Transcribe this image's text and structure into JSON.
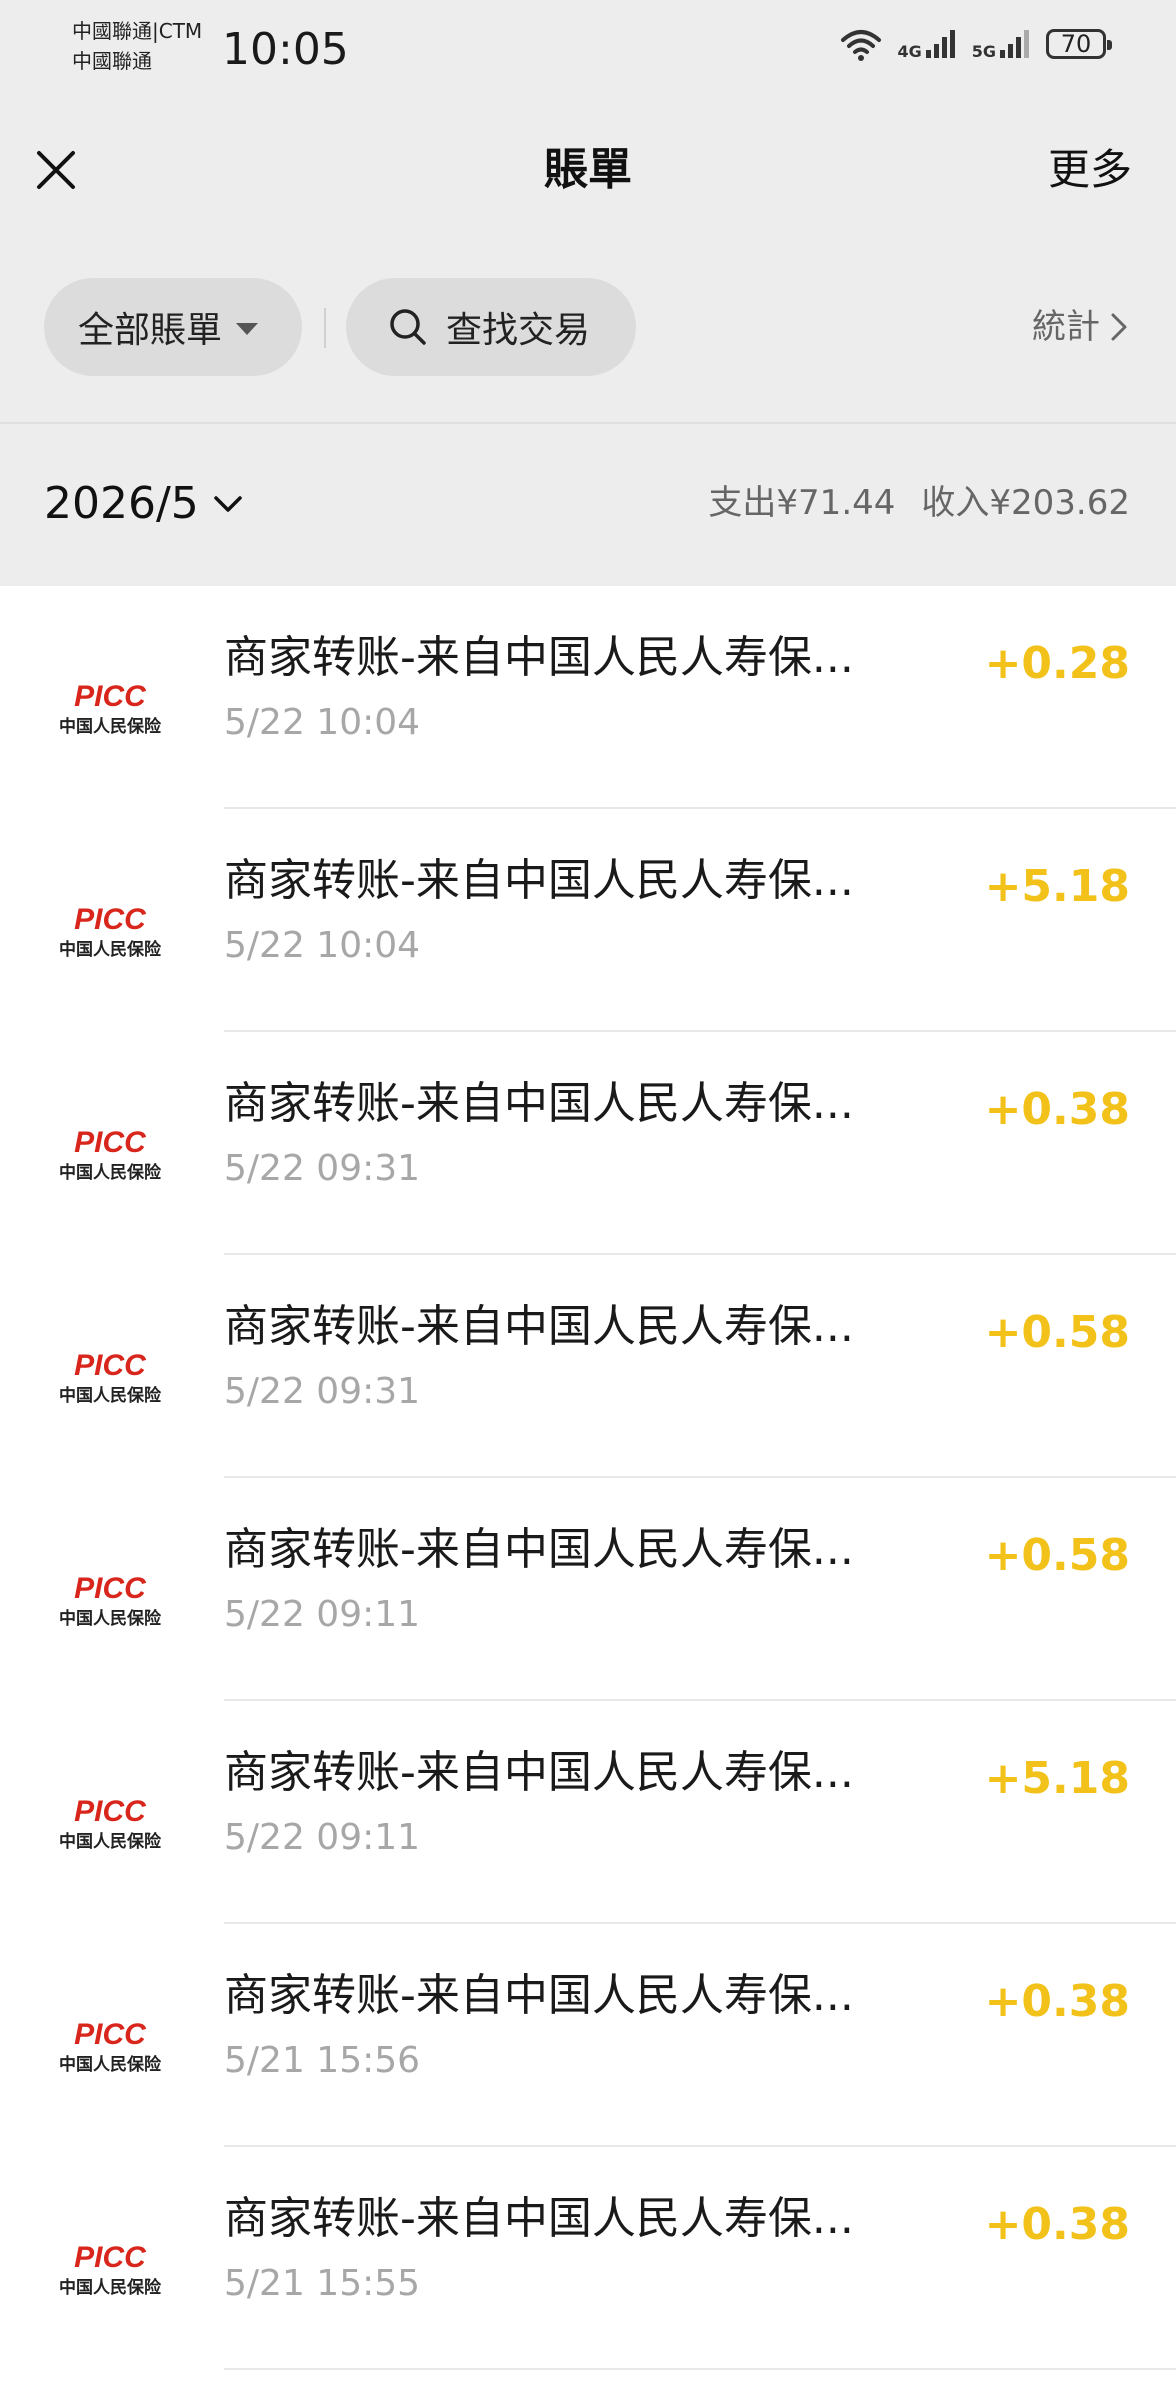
{
  "status_bar": {
    "carrier_line1": "中國聯通|CTM",
    "carrier_line2": "中國聯通",
    "time": "10:05",
    "network_4g": "4G",
    "network_5g": "5G",
    "battery": "70"
  },
  "nav": {
    "title": "賬單",
    "more": "更多"
  },
  "filters": {
    "all_bills": "全部賬單",
    "search": "查找交易",
    "stats": "統計"
  },
  "month": {
    "label": "2026/5",
    "expense": "支出¥71.44",
    "income": "收入¥203.62"
  },
  "logo": {
    "brand": "PICC",
    "name": "中国人民保险",
    "brand_color": "#d9261c"
  },
  "transactions": [
    {
      "title": "商家转账-来自中国人民人寿保...",
      "time": "5/22 10:04",
      "amount": "+0.28"
    },
    {
      "title": "商家转账-来自中国人民人寿保...",
      "time": "5/22 10:04",
      "amount": "+5.18"
    },
    {
      "title": "商家转账-来自中国人民人寿保...",
      "time": "5/22 09:31",
      "amount": "+0.38"
    },
    {
      "title": "商家转账-来自中国人民人寿保...",
      "time": "5/22 09:31",
      "amount": "+0.58"
    },
    {
      "title": "商家转账-来自中国人民人寿保...",
      "time": "5/22 09:11",
      "amount": "+0.58"
    },
    {
      "title": "商家转账-来自中国人民人寿保...",
      "time": "5/22 09:11",
      "amount": "+5.18"
    },
    {
      "title": "商家转账-来自中国人民人寿保...",
      "time": "5/21 15:56",
      "amount": "+0.38"
    },
    {
      "title": "商家转账-来自中国人民人寿保...",
      "time": "5/21 15:55",
      "amount": "+0.38"
    }
  ],
  "colors": {
    "income_amount": "#f2c21a",
    "header_background": "#ededed"
  }
}
